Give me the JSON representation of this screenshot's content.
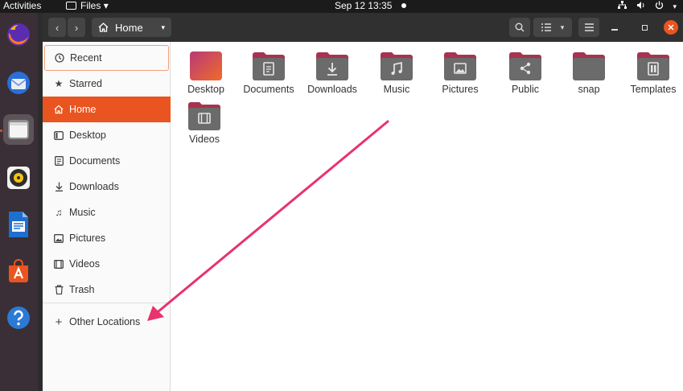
{
  "topbar": {
    "activities": "Activities",
    "app_menu": "Files",
    "clock": "Sep 12  13:35"
  },
  "header": {
    "path_label": "Home"
  },
  "sidebar": {
    "items": [
      {
        "label": "Recent",
        "icon": "clock-icon"
      },
      {
        "label": "Starred",
        "icon": "star-icon"
      },
      {
        "label": "Home",
        "icon": "home-icon"
      },
      {
        "label": "Desktop",
        "icon": "desktop-icon"
      },
      {
        "label": "Documents",
        "icon": "document-icon"
      },
      {
        "label": "Downloads",
        "icon": "download-icon"
      },
      {
        "label": "Music",
        "icon": "music-icon"
      },
      {
        "label": "Pictures",
        "icon": "picture-icon"
      },
      {
        "label": "Videos",
        "icon": "video-icon"
      },
      {
        "label": "Trash",
        "icon": "trash-icon"
      }
    ],
    "other_locations": "Other Locations"
  },
  "folders": [
    {
      "label": "Desktop",
      "icon": "desktop-folder-icon"
    },
    {
      "label": "Documents",
      "icon": "documents-folder-icon"
    },
    {
      "label": "Downloads",
      "icon": "downloads-folder-icon"
    },
    {
      "label": "Music",
      "icon": "music-folder-icon"
    },
    {
      "label": "Pictures",
      "icon": "pictures-folder-icon"
    },
    {
      "label": "Public",
      "icon": "public-folder-icon"
    },
    {
      "label": "snap",
      "icon": "folder-icon"
    },
    {
      "label": "Templates",
      "icon": "templates-folder-icon"
    },
    {
      "label": "Videos",
      "icon": "videos-folder-icon"
    }
  ],
  "colors": {
    "accent": "#e95420",
    "arrow": "#e8336d",
    "folder_tab": "#a8334e",
    "folder_body": "#6b6b6b"
  }
}
